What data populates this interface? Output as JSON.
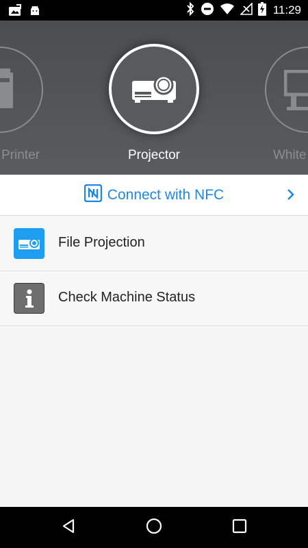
{
  "status_bar": {
    "time": "11:29",
    "left_icons": [
      "photo-upload-icon",
      "android-icon"
    ],
    "right_icons": [
      "bluetooth-icon",
      "do-not-disturb-icon",
      "wifi-icon",
      "no-sim-icon",
      "battery-charging-icon"
    ]
  },
  "carousel": {
    "devices": [
      {
        "name": "Printer",
        "icon": "printer-icon"
      },
      {
        "name": "Projector",
        "icon": "projector-icon",
        "selected": true
      },
      {
        "name": "Whiteboard",
        "display_label": "White",
        "icon": "whiteboard-icon"
      }
    ]
  },
  "nfc": {
    "label": "Connect with NFC",
    "icon": "nfc-icon",
    "accent_color": "#1e88e5"
  },
  "menu": {
    "items": [
      {
        "label": "File Projection",
        "icon": "projector-icon",
        "icon_color": "#1e9ef0"
      },
      {
        "label": "Check Machine Status",
        "icon": "info-icon",
        "icon_color": "#6e6e6e"
      }
    ]
  },
  "nav_bar": {
    "buttons": [
      "back-icon",
      "home-icon",
      "recents-icon"
    ]
  }
}
